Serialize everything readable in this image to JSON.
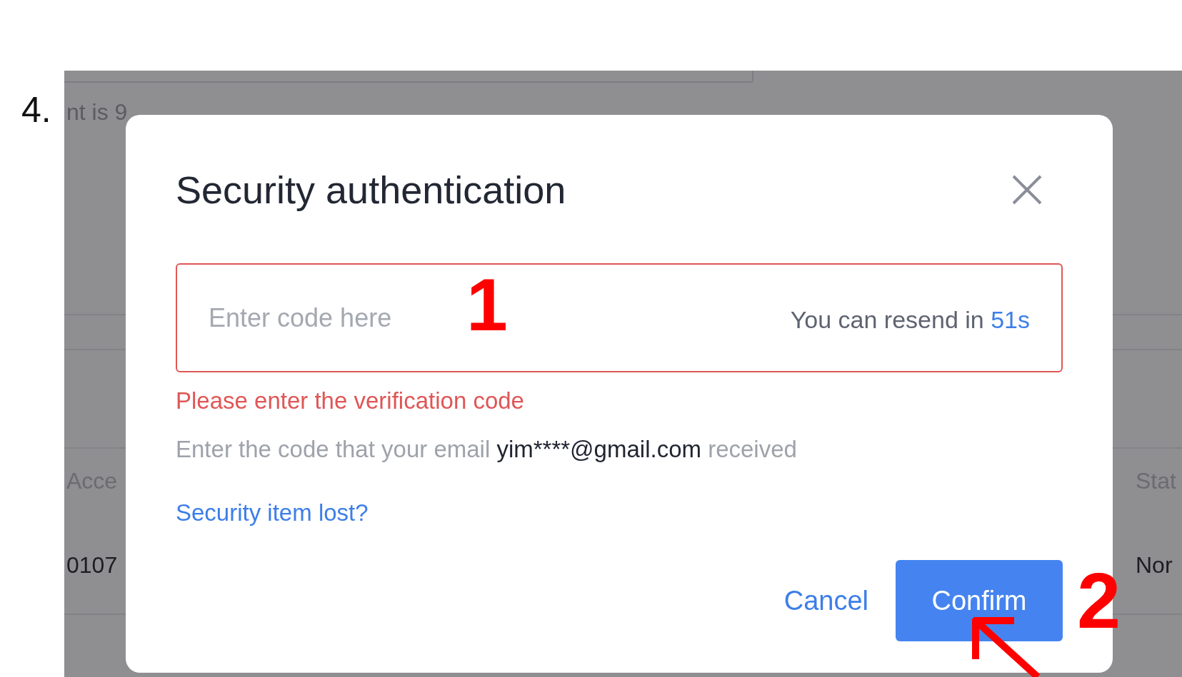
{
  "annotations": {
    "step": "4.",
    "marker_1": "1",
    "marker_2": "2"
  },
  "background": {
    "field_text": "nt is 9",
    "columns": [
      {
        "header": "Acce",
        "value": "0107"
      },
      {
        "header": "Stat",
        "value": "Nor"
      }
    ]
  },
  "dialog": {
    "title": "Security authentication",
    "code_field": {
      "placeholder": "Enter code here",
      "invalid": true,
      "resend_label": "You can resend in",
      "resend_timer": "51s"
    },
    "error": "Please enter the verification code",
    "hint": {
      "before": "Enter the code that your email",
      "email": "yim****@gmail.com",
      "after": "received"
    },
    "link": "Security item lost?",
    "buttons": [
      {
        "label": "Cancel",
        "kind": "link"
      },
      {
        "label": "Confirm",
        "kind": "primary"
      }
    ]
  }
}
